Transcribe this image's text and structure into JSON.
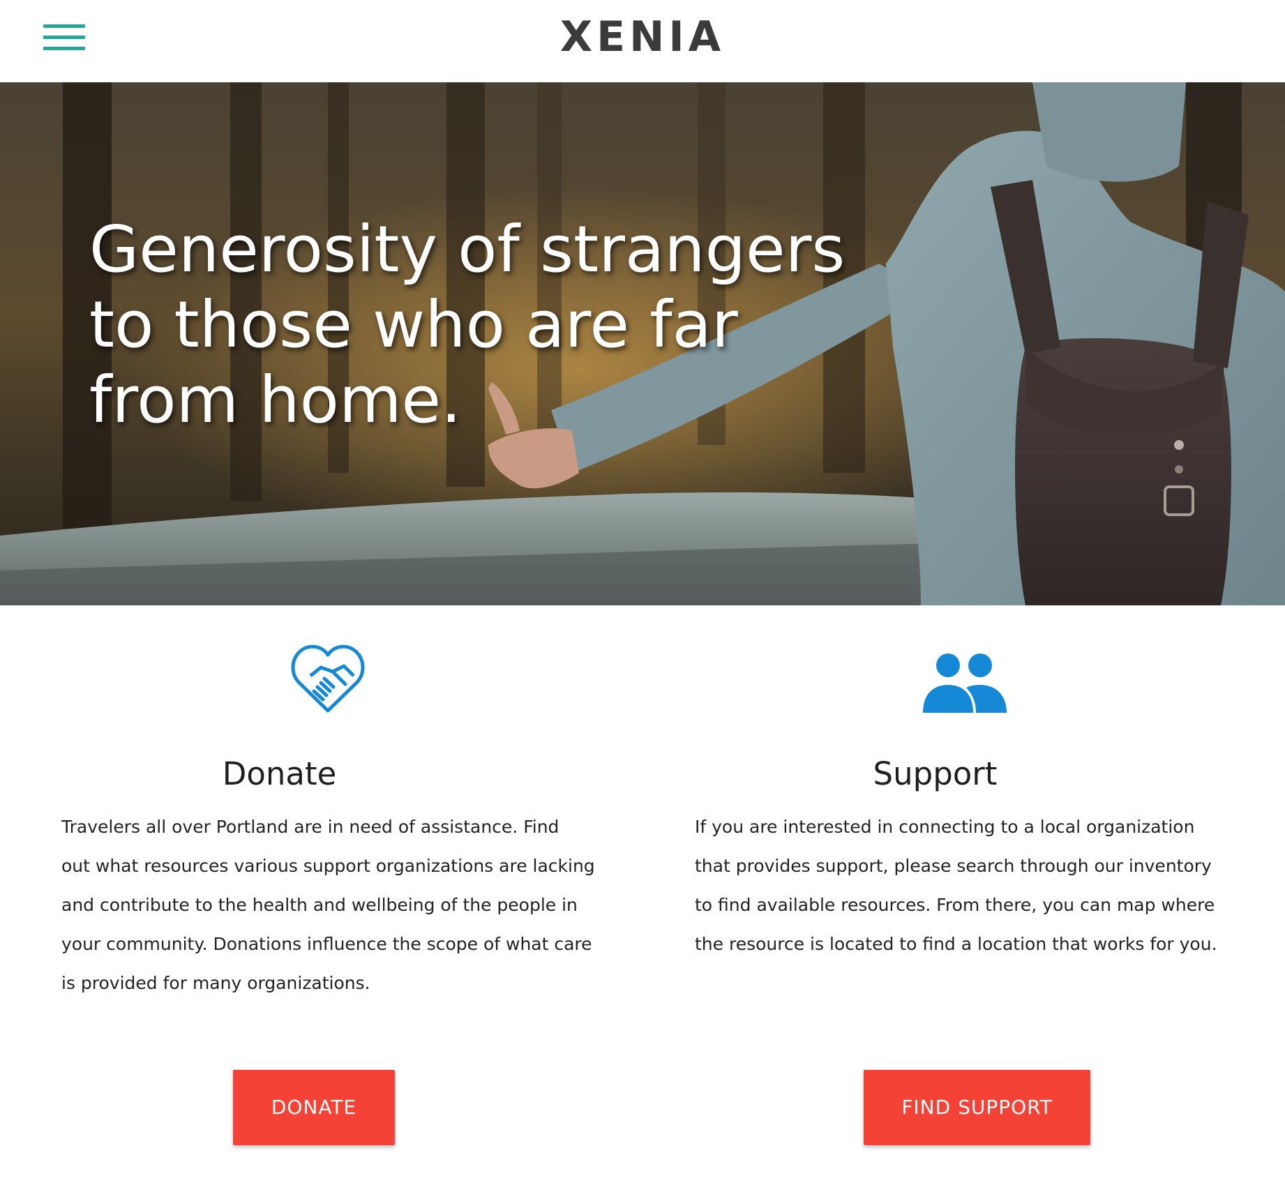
{
  "header": {
    "brand": "XENIA",
    "menu_icon": "hamburger-menu-icon",
    "accent_color": "#26a69a"
  },
  "hero": {
    "title_lines": [
      "Generosity of strangers",
      "to those who are far",
      "from home."
    ]
  },
  "features": [
    {
      "icon": "heart-handshake-icon",
      "title": "Donate",
      "text_lines": [
        "Travelers all over Portland are in need of assistance. Find",
        "out what resources various support organizations are lacking",
        "and contribute to the health and wellbeing of the people in",
        "your community. Donations influence the scope of what care",
        "is provided for many organizations."
      ],
      "button_label": "DONATE"
    },
    {
      "icon": "people-icon",
      "title": "Support",
      "text_lines": [
        "If you are interested in connecting to a local organization",
        "that provides support, please search through our inventory",
        "to find available resources. From there, you can map where",
        "the resource is located to find a location that works for you."
      ],
      "button_label": "FIND SUPPORT"
    }
  ],
  "colors": {
    "icon_blue": "#1588d6",
    "button_red": "#f44336",
    "brand_text": "#3b3b3b"
  }
}
